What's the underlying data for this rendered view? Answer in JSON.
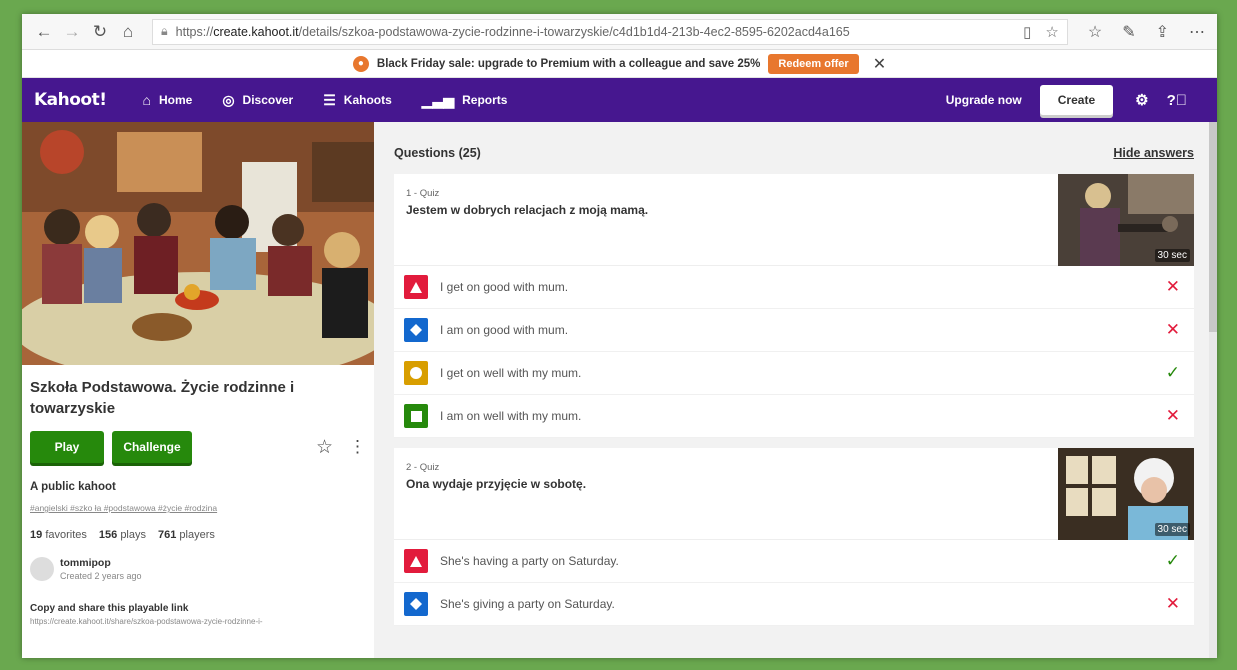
{
  "browser": {
    "url_prefix": "https://",
    "url_host": "create.kahoot.it",
    "url_path": "/details/szkoa-podstawowa-zycie-rodzinne-i-towarzyskie/c4d1b1d4-213b-4ec2-8595-6202acd4a165"
  },
  "promo": {
    "text": "Black Friday sale: upgrade to Premium with a colleague and save 25%",
    "button": "Redeem offer"
  },
  "nav": {
    "logo": "Kahoot!",
    "links": [
      "Home",
      "Discover",
      "Kahoots",
      "Reports"
    ],
    "upgrade": "Upgrade now",
    "create": "Create"
  },
  "kahoot": {
    "title": "Szkoła Podstawowa. Życie rodzinne i towarzyskie",
    "play": "Play",
    "challenge": "Challenge",
    "visibility": "A public kahoot",
    "tags": "#angielski #szko ła #podstawowa #życie #rodzina",
    "favorites": "19",
    "favorites_label": "favorites",
    "plays": "156",
    "plays_label": "plays",
    "players": "761",
    "players_label": "players",
    "creator": "tommipop",
    "created": "Created 2 years ago",
    "share_label": "Copy and share this playable link",
    "share_link": "https://create.kahoot.it/share/szkoa-podstawowa-zycie-rodzinne-i-"
  },
  "questions_header": "Questions (25)",
  "hide_answers": "Hide answers",
  "questions": [
    {
      "label": "1 - Quiz",
      "title": "Jestem w dobrych relacjach z moją mamą.",
      "time": "30 sec",
      "answers": [
        {
          "text": "I get on good with mum.",
          "correct": false
        },
        {
          "text": "I am on good with mum.",
          "correct": false
        },
        {
          "text": "I get on well with my mum.",
          "correct": true
        },
        {
          "text": "I am on well with my mum.",
          "correct": false
        }
      ]
    },
    {
      "label": "2 - Quiz",
      "title": "Ona wydaje przyjęcie w sobotę.",
      "time": "30 sec",
      "answers": [
        {
          "text": "She's having a party on Saturday.",
          "correct": true
        },
        {
          "text": "She's giving a party on Saturday.",
          "correct": false
        }
      ]
    }
  ],
  "colors": {
    "brand": "#46178f",
    "red": "#e21b3c",
    "blue": "#1368ce",
    "yellow": "#d89e00",
    "green": "#26890c",
    "promo": "#e8772e"
  },
  "icons": {
    "triangle": "triangle-icon",
    "diamond": "diamond-icon",
    "circle": "circle-icon",
    "square": "square-icon",
    "correct": "check-icon",
    "wrong": "cross-icon"
  }
}
